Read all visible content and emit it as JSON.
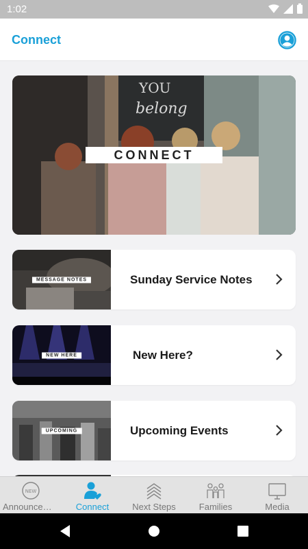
{
  "status_bar": {
    "time": "1:02"
  },
  "app_bar": {
    "title": "Connect"
  },
  "hero": {
    "label": "CONNECT"
  },
  "cards": [
    {
      "thumb_label": "MESSAGE NOTES",
      "title": "Sunday Service Notes"
    },
    {
      "thumb_label": "NEW HERE",
      "title": "New Here?"
    },
    {
      "thumb_label": "UPCOMING",
      "title": "Upcoming Events"
    }
  ],
  "bottom_nav": {
    "items": [
      {
        "label": "Announcem…",
        "icon": "new-badge-icon",
        "badge": "NEW"
      },
      {
        "label": "Connect",
        "icon": "person-heart-icon",
        "active": true
      },
      {
        "label": "Next Steps",
        "icon": "stairs-icon"
      },
      {
        "label": "Families",
        "icon": "family-icon"
      },
      {
        "label": "Media",
        "icon": "monitor-icon"
      }
    ]
  },
  "colors": {
    "accent": "#1aa0d8",
    "status_bar": "#bdbdbd",
    "nav_background": "#e3e3e3"
  }
}
